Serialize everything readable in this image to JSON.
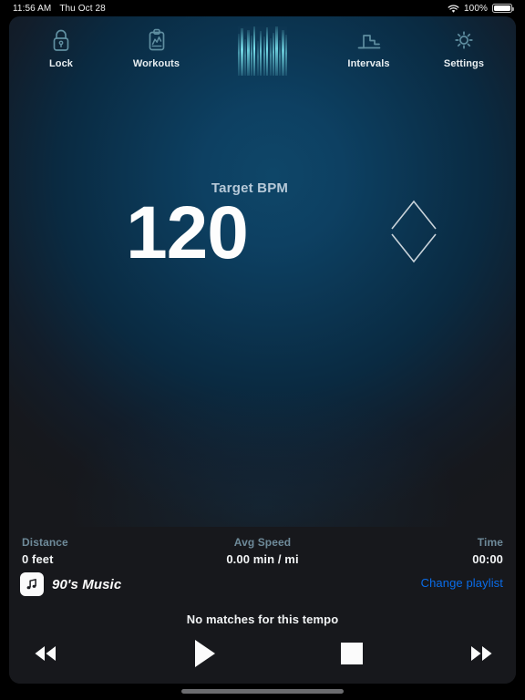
{
  "statusbar": {
    "time": "11:56 AM",
    "date": "Thu Oct 28",
    "wifi_icon": "wifi-icon",
    "battery_percent": "100%",
    "battery_icon": "battery-full-icon"
  },
  "toolbar": {
    "items": [
      {
        "id": "lock",
        "label": "Lock",
        "icon": "lock-icon"
      },
      {
        "id": "workouts",
        "label": "Workouts",
        "icon": "clipboard-chart-icon"
      },
      {
        "id": "logo",
        "label": "",
        "icon": "waveform-bars-logo"
      },
      {
        "id": "intervals",
        "label": "Intervals",
        "icon": "steps-chart-icon"
      },
      {
        "id": "settings",
        "label": "Settings",
        "icon": "gear-icon"
      }
    ]
  },
  "tempo": {
    "label": "Target BPM",
    "value": "120",
    "stepper_up_icon": "chevron-up-icon",
    "stepper_down_icon": "chevron-down-icon"
  },
  "stats": [
    {
      "id": "distance",
      "label": "Distance",
      "value": "0 feet"
    },
    {
      "id": "avg_speed",
      "label": "Avg Speed",
      "value": "0.00 min / mi"
    },
    {
      "id": "time",
      "label": "Time",
      "value": "00:00"
    }
  ],
  "playlist": {
    "icon": "music-note-icon",
    "name": "90's Music",
    "change_label": "Change playlist",
    "status": "No matches for this tempo"
  },
  "transport": {
    "previous": {
      "label": "Previous track",
      "icon": "rewind-icon"
    },
    "play": {
      "label": "Play",
      "icon": "play-icon"
    },
    "stop": {
      "label": "Stop",
      "icon": "stop-icon"
    },
    "next": {
      "label": "Next track",
      "icon": "fast-forward-icon"
    }
  },
  "colors": {
    "accent_cyan": "#79e3ef",
    "icon_teal": "#5f8ea0",
    "link_blue": "#0a6ce8",
    "stat_label": "#6e8a99",
    "bpm_label": "#b6c9d8",
    "background_deep_blue": "#0e4668",
    "panel_dark": "#17181c"
  }
}
